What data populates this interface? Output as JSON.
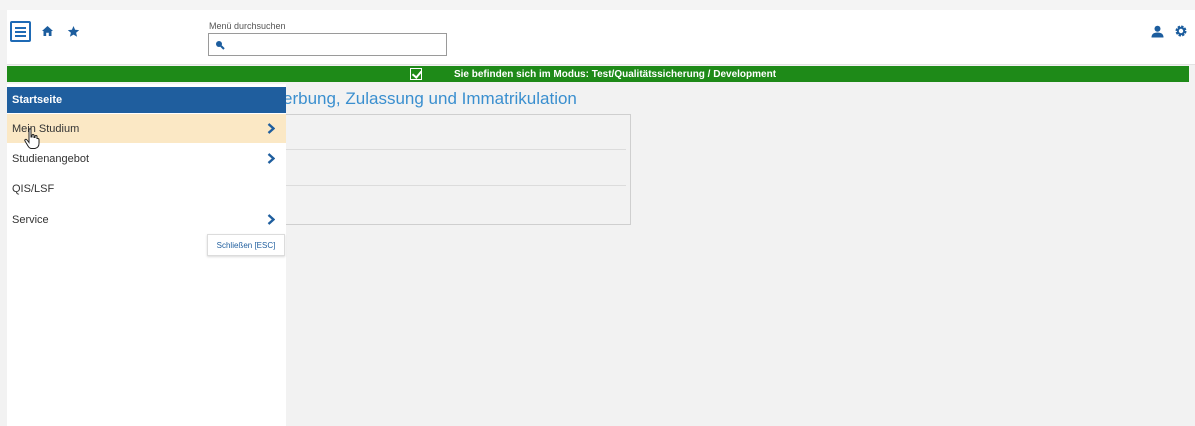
{
  "header": {
    "search_label": "Menü durchsuchen",
    "search_value": ""
  },
  "icons": {
    "menu": "hamburger-icon",
    "home": "home-icon",
    "favorites": "star-icon",
    "search": "search-icon",
    "user": "user-icon",
    "settings": "gear-icon"
  },
  "mode_bar": {
    "text": "Sie befinden sich im Modus: Test/Qualitätssicherung / Development"
  },
  "main": {
    "title_visible": "erbung, Zulassung und Immatrikulation"
  },
  "sidebar": {
    "header": "Startseite",
    "items": [
      {
        "label": "Mein Studium",
        "has_submenu": true
      },
      {
        "label": "Studienangebot",
        "has_submenu": true
      },
      {
        "label": "QIS/LSF",
        "has_submenu": false
      },
      {
        "label": "Service",
        "has_submenu": true
      }
    ],
    "close_label": "Schließen [ESC]"
  },
  "colors": {
    "primary": "#1f5e9e",
    "mode_bar": "#1e8a18",
    "hover": "#fbe8c5",
    "title": "#3a8fcf"
  }
}
